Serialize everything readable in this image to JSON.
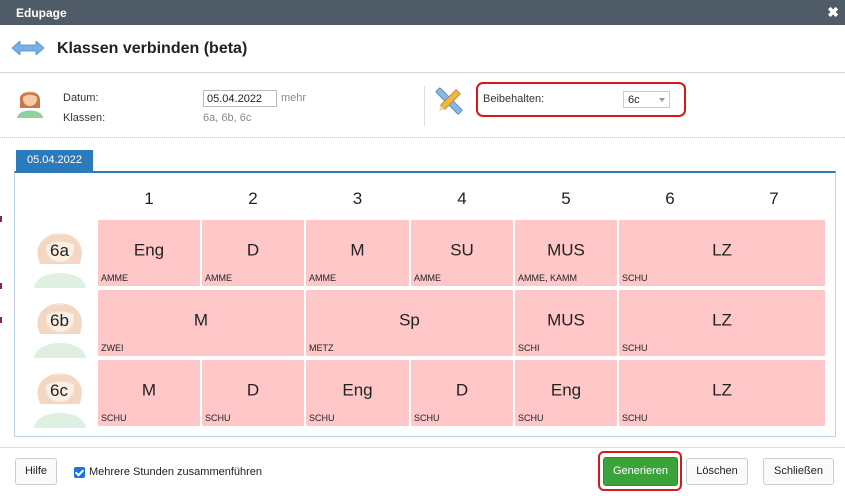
{
  "window": {
    "title": "Edupage",
    "close_glyph": "✖"
  },
  "dialog": {
    "title": "Klassen verbinden (beta)"
  },
  "form": {
    "datum_label": "Datum:",
    "datum_value": "05.04.2022",
    "mehr_link": "mehr",
    "klassen_label": "Klassen:",
    "klassen_value": "6a, 6b, 6c",
    "beibehalten_label": "Beibehalten:",
    "beibehalten_value": "6c"
  },
  "tab": {
    "label": "05.04.2022"
  },
  "periods": [
    "1",
    "2",
    "3",
    "4",
    "5",
    "6",
    "7"
  ],
  "rows": [
    {
      "class": "6a",
      "cells": [
        {
          "subject": "Eng",
          "teacher": "AMME"
        },
        {
          "subject": "D",
          "teacher": "AMME"
        },
        {
          "subject": "M",
          "teacher": "AMME"
        },
        {
          "subject": "SU",
          "teacher": "AMME"
        },
        {
          "subject": "MUS",
          "teacher": "AMME, KAMM"
        },
        {
          "subject": "LZ",
          "teacher": "SCHU"
        }
      ]
    },
    {
      "class": "6b",
      "cells": [
        {
          "subject": "M",
          "teacher": "ZWEI"
        },
        {
          "subject": "Sp",
          "teacher": "METZ"
        },
        {
          "subject": "MUS",
          "teacher": "SCHI"
        },
        {
          "subject": "LZ",
          "teacher": "SCHU"
        }
      ]
    },
    {
      "class": "6c",
      "cells": [
        {
          "subject": "M",
          "teacher": "SCHU"
        },
        {
          "subject": "D",
          "teacher": "SCHU"
        },
        {
          "subject": "Eng",
          "teacher": "SCHU"
        },
        {
          "subject": "D",
          "teacher": "SCHU"
        },
        {
          "subject": "Eng",
          "teacher": "SCHU"
        },
        {
          "subject": "LZ",
          "teacher": "SCHU"
        }
      ]
    }
  ],
  "footer": {
    "hilfe": "Hilfe",
    "checkbox_label": "Mehrere Stunden zusammenführen",
    "checkbox_checked": true,
    "generieren": "Generieren",
    "loeschen": "Löschen",
    "schliessen": "Schließen"
  },
  "colors": {
    "titlebar": "#4f5b66",
    "accent_blue": "#2a7abc",
    "lesson_pink": "#ffc7c7",
    "highlight_red": "#d9161c",
    "primary_green": "#3aa33a"
  },
  "icons": {
    "header": "double-arrow-icon",
    "user": "user-avatar-icon",
    "tools": "pencil-ruler-icon",
    "class": "student-avatar-icon"
  }
}
